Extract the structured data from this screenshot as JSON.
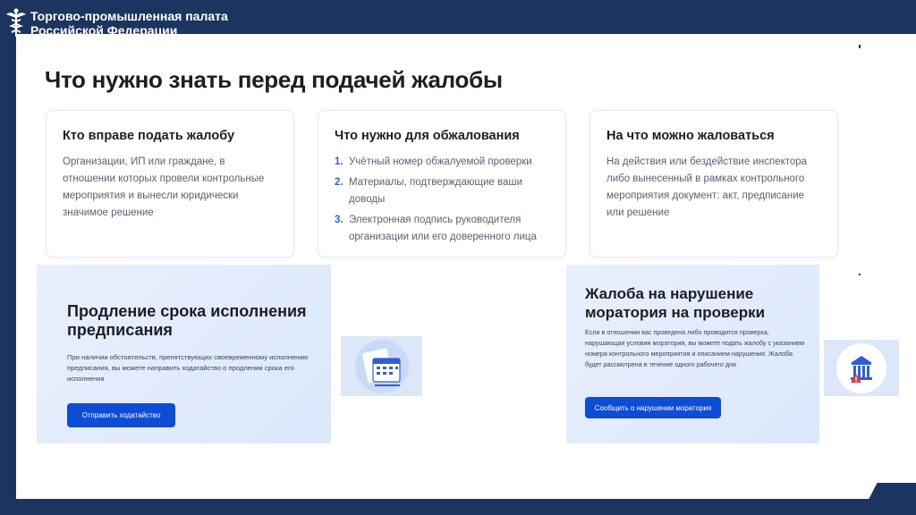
{
  "header": {
    "org_line1": "Торгово-промышленная палата",
    "org_line2": "Российской Федерации",
    "logo_icon": "caduceus-icon"
  },
  "page_title": "Что нужно знать перед подачей жалобы",
  "cards": [
    {
      "title": "Кто вправе подать жалобу",
      "text": "Организации, ИП или граждане, в отношении которых провели контрольные мероприятия и вынесли юридически значимое решение"
    },
    {
      "title": "Что нужно для обжалования",
      "items": [
        {
          "num": "1.",
          "text": "Учётный номер обжалуемой проверки"
        },
        {
          "num": "2.",
          "text": "Материалы, подтверждающие ваши доводы"
        },
        {
          "num": "3.",
          "text": "Электронная подпись руководителя организации или его доверенного лица"
        }
      ]
    },
    {
      "title": "На что можно жаловаться",
      "text": "На действия или бездействие инспектора либо вынесенный в рамках контрольного мероприятия документ: акт, предписание или решение"
    }
  ],
  "banner_extension": {
    "title": "Продление срока исполнения предписания",
    "text": "При наличии обстоятельств, препятствующих своевременному исполнению предписания, вы можете направить ходатайство о продлении срока его исполнения",
    "button": "Отправить ходатайство",
    "icon": "calendar-document-icon"
  },
  "banner_moratorium": {
    "title": "Жалоба на нарушение моратория на проверки",
    "text": "Если в отношении вас проведена либо проводится проверка, нарушающая условия моратория, вы можете подать жалобу с указанием номера контрольного мероприятия и описанием нарушения. Жалоба будет рассмотрена в течение одного рабочего дня",
    "button": "Сообщить о нарушении моратория",
    "icon": "building-warning-icon"
  },
  "colors": {
    "frame": "#1c3560",
    "accent_button": "#0d4cd3",
    "list_number": "#2f5fd6",
    "banner_bg": "#e3ecfc"
  }
}
